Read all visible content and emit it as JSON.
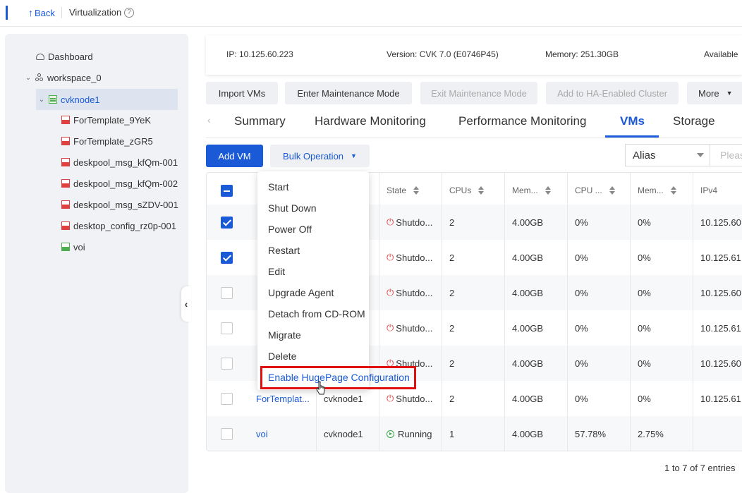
{
  "topbar": {
    "back_label": "Back",
    "breadcrumb": "Virtualization"
  },
  "sidebar": {
    "items": [
      {
        "label": "Dashboard"
      },
      {
        "label": "workspace_0"
      },
      {
        "label": "cvknode1"
      },
      {
        "label": "ForTemplate_9YeK"
      },
      {
        "label": "ForTemplate_zGR5"
      },
      {
        "label": "deskpool_msg_kfQm-001"
      },
      {
        "label": "deskpool_msg_kfQm-002"
      },
      {
        "label": "deskpool_msg_sZDV-001"
      },
      {
        "label": "desktop_config_rz0p-001"
      },
      {
        "label": "voi"
      }
    ]
  },
  "info": {
    "ip": "IP: 10.125.60.223",
    "version": "Version: CVK 7.0 (E0746P45)",
    "memory": "Memory: 251.30GB",
    "available": "Available"
  },
  "actions": {
    "import_vms": "Import VMs",
    "enter_maintenance": "Enter Maintenance Mode",
    "exit_maintenance": "Exit Maintenance Mode",
    "add_ha": "Add to HA-Enabled Cluster",
    "more": "More"
  },
  "tabs": [
    "Summary",
    "Hardware Monitoring",
    "Performance Monitoring",
    "VMs",
    "Storage"
  ],
  "toolbar": {
    "add_vm": "Add VM",
    "bulk_operation": "Bulk Operation"
  },
  "filter": {
    "field": "Alias",
    "placeholder": "Pleas"
  },
  "table": {
    "headers": [
      "State",
      "CPUs",
      "Mem...",
      "CPU ...",
      "Mem...",
      "IPv4"
    ],
    "rows": [
      {
        "name": "",
        "host": "",
        "state": "Shutdo...",
        "cpus": "2",
        "mem": "4.00GB",
        "cpu_usage": "0%",
        "mem_usage": "0%",
        "ipv4": "10.125.60.",
        "checked": true
      },
      {
        "name": "",
        "host": "",
        "state": "Shutdo...",
        "cpus": "2",
        "mem": "4.00GB",
        "cpu_usage": "0%",
        "mem_usage": "0%",
        "ipv4": "10.125.61.",
        "checked": true
      },
      {
        "name": "",
        "host": "",
        "state": "Shutdo...",
        "cpus": "2",
        "mem": "4.00GB",
        "cpu_usage": "0%",
        "mem_usage": "0%",
        "ipv4": "10.125.60.",
        "checked": false
      },
      {
        "name": "",
        "host": "",
        "state": "Shutdo...",
        "cpus": "2",
        "mem": "4.00GB",
        "cpu_usage": "0%",
        "mem_usage": "0%",
        "ipv4": "10.125.61.",
        "checked": false
      },
      {
        "name": "",
        "host": "",
        "state": "Shutdo...",
        "cpus": "2",
        "mem": "4.00GB",
        "cpu_usage": "0%",
        "mem_usage": "0%",
        "ipv4": "10.125.60.",
        "checked": false
      },
      {
        "name": "ForTemplat...",
        "host": "cvknode1",
        "state": "Shutdo...",
        "cpus": "2",
        "mem": "4.00GB",
        "cpu_usage": "0%",
        "mem_usage": "0%",
        "ipv4": "10.125.61.",
        "checked": false
      },
      {
        "name": "voi",
        "host": "cvknode1",
        "state": "Running",
        "cpus": "1",
        "mem": "4.00GB",
        "cpu_usage": "57.78%",
        "mem_usage": "2.75%",
        "ipv4": "",
        "checked": false
      }
    ]
  },
  "pagination": "1 to 7 of 7 entries",
  "bulk_menu": [
    "Start",
    "Shut Down",
    "Power Off",
    "Restart",
    "Edit",
    "Upgrade Agent",
    "Detach from CD-ROM",
    "Migrate",
    "Delete",
    "Enable HugePage Configuration"
  ],
  "colors": {
    "accent": "#1a5ad7",
    "danger": "#e04040",
    "success": "#3aa845",
    "highlight_border": "#e01010"
  }
}
